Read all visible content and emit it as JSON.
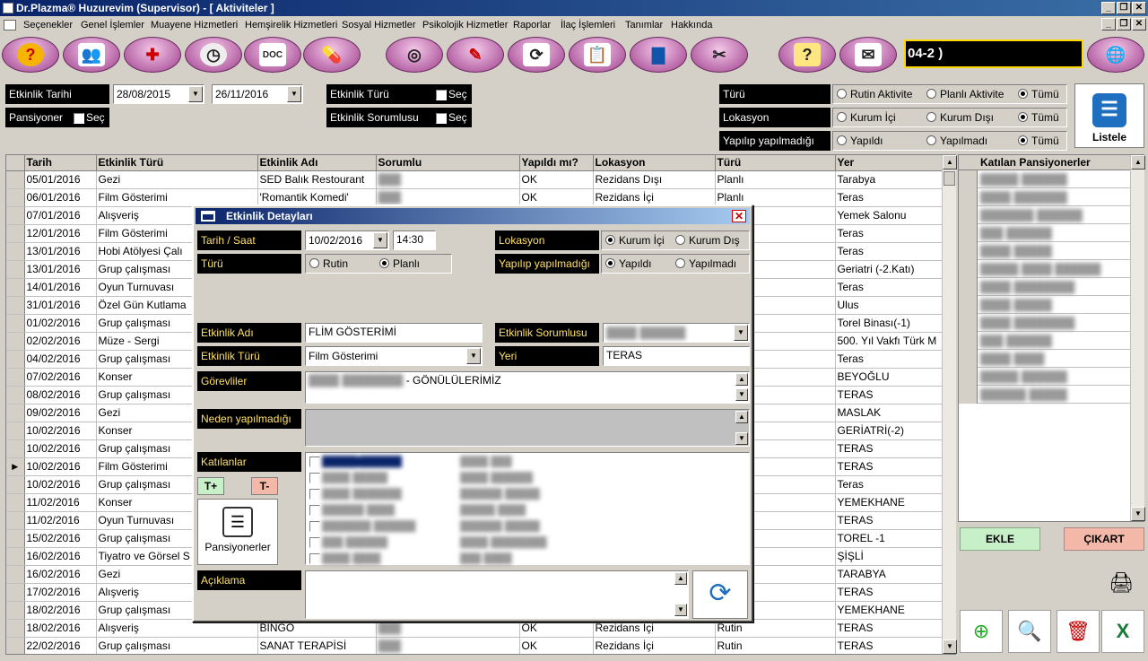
{
  "window": {
    "title": "Dr.Plazma® Huzurevim (Supervisor) - [ Aktiviteler ]",
    "min": "_",
    "restore": "❐",
    "close": "✕"
  },
  "menu": [
    "Seçenekler",
    "Genel İşlemler",
    "Muayene Hizmetleri",
    "Hemşirelik Hizmetleri",
    "Sosyal Hizmetler",
    "Psikolojik Hizmetler",
    "Raporlar",
    "İlaç İşlemleri",
    "Tanımlar",
    "Hakkında"
  ],
  "toolbar": {
    "ticker": "04-2 )",
    "icons": [
      "help-icon",
      "doctors-icon",
      "nurse-icon",
      "clock-icon",
      "document-icon",
      "pills-icon",
      "spiral-icon",
      "note-icon",
      "refresh-doc-icon",
      "clipboard-icon",
      "chart-icon",
      "tools-icon",
      "question-note-icon",
      "mail-icon",
      "globe-icon"
    ]
  },
  "filters": {
    "etkinlik_tarihi": "Etkinlik Tarihi",
    "date_from": "28/08/2015",
    "date_to": "26/11/2016",
    "pansiyoner": "Pansiyoner",
    "sec": "Seç",
    "etkinlik_turu": "Etkinlik Türü",
    "etkinlik_sorumlusu": "Etkinlik Sorumlusu",
    "turu": "Türü",
    "turu_opts": [
      "Rutin Aktivite",
      "Planlı Aktivite",
      "Tümü"
    ],
    "lokasyon": "Lokasyon",
    "lokasyon_opts": [
      "Kurum İçi",
      "Kurum Dışı",
      "Tümü"
    ],
    "yapilip": "Yapılıp yapılmadığı",
    "yapilip_opts": [
      "Yapıldı",
      "Yapılmadı",
      "Tümü"
    ],
    "listele": "Listele"
  },
  "grid": {
    "headers": [
      "Tarih",
      "Etkinlik Türü",
      "Etkinlik Adı",
      "Sorumlu",
      "Yapıldı mı?",
      "Lokasyon",
      "Türü",
      "Yer"
    ],
    "rows": [
      [
        "05/01/2016",
        "Gezi",
        "SED Balık Restourant",
        "███",
        "OK",
        "Rezidans Dışı",
        "Planlı",
        "Tarabya"
      ],
      [
        "06/01/2016",
        "Film Gösterimi",
        "'Romantik Komedi'",
        "███",
        "OK",
        "Rezidans İçi",
        "Planlı",
        "Teras"
      ],
      [
        "07/01/2016",
        "Alışveriş",
        "",
        "",
        "",
        "",
        "",
        "Yemek Salonu"
      ],
      [
        "12/01/2016",
        "Film Gösterimi",
        "",
        "",
        "",
        "",
        "",
        "Teras"
      ],
      [
        "13/01/2016",
        "Hobi Atölyesi Çalı",
        "",
        "",
        "",
        "",
        "",
        "Teras"
      ],
      [
        "13/01/2016",
        "Grup çalışması",
        "",
        "",
        "",
        "",
        "",
        "Geriatri (-2.Katı)"
      ],
      [
        "14/01/2016",
        "Oyun Turnuvası",
        "",
        "",
        "",
        "",
        "",
        "Teras"
      ],
      [
        "31/01/2016",
        "Özel Gün Kutlama",
        "",
        "",
        "",
        "",
        "",
        "Ulus"
      ],
      [
        "01/02/2016",
        "Grup çalışması",
        "",
        "",
        "",
        "",
        "",
        "Torel Binası(-1)"
      ],
      [
        "02/02/2016",
        "Müze - Sergi",
        "",
        "",
        "",
        "",
        "",
        "500. Yıl Vakfı Türk M"
      ],
      [
        "04/02/2016",
        "Grup çalışması",
        "",
        "",
        "",
        "",
        "",
        "Teras"
      ],
      [
        "07/02/2016",
        "Konser",
        "",
        "",
        "",
        "",
        "",
        "BEYOĞLU"
      ],
      [
        "08/02/2016",
        "Grup çalışması",
        "",
        "",
        "",
        "",
        "",
        "TERAS"
      ],
      [
        "09/02/2016",
        "Gezi",
        "",
        "",
        "",
        "",
        "",
        "MASLAK"
      ],
      [
        "10/02/2016",
        "Konser",
        "",
        "",
        "",
        "",
        "",
        "GERİATRİ(-2)"
      ],
      [
        "10/02/2016",
        "Grup çalışması",
        "",
        "",
        "",
        "",
        "",
        "TERAS"
      ],
      [
        "10/02/2016",
        "Film Gösterimi",
        "",
        "",
        "",
        "",
        "",
        "TERAS"
      ],
      [
        "10/02/2016",
        "Grup çalışması",
        "",
        "",
        "",
        "",
        "",
        "Teras"
      ],
      [
        "11/02/2016",
        "Konser",
        "",
        "",
        "",
        "",
        "",
        "YEMEKHANE"
      ],
      [
        "11/02/2016",
        "Oyun Turnuvası",
        "",
        "",
        "",
        "",
        "",
        "TERAS"
      ],
      [
        "15/02/2016",
        "Grup çalışması",
        "",
        "",
        "",
        "",
        "",
        "TOREL -1"
      ],
      [
        "16/02/2016",
        "Tiyatro ve Görsel S",
        "",
        "",
        "",
        "",
        "",
        "ŞİŞLİ"
      ],
      [
        "16/02/2016",
        "Gezi",
        "",
        "",
        "",
        "",
        "",
        "TARABYA"
      ],
      [
        "17/02/2016",
        "Alışveriş",
        "",
        "",
        "",
        "",
        "",
        "TERAS"
      ],
      [
        "18/02/2016",
        "Grup çalışması",
        "",
        "",
        "",
        "",
        "",
        "YEMEKHANE"
      ],
      [
        "18/02/2016",
        "Alışveriş",
        "BINGO",
        "███",
        "OK",
        "Rezidans İçi",
        "Rutin",
        "TERAS"
      ],
      [
        "22/02/2016",
        "Grup çalışması",
        "SANAT TERAPİSİ",
        "███",
        "OK",
        "Rezidans İçi",
        "Rutin",
        "TERAS"
      ]
    ],
    "current_row": 16
  },
  "katilan": {
    "header": "Katılan Pansiyonerler",
    "rows": [
      "█████ ██████",
      "████ ███████",
      "███████ ██████",
      "███ ██████",
      "████ █████",
      "█████ ████ ██████",
      "████ ████████",
      "████ █████",
      "████ ████████",
      "███ ██████",
      "████ ████",
      "█████ ██████",
      "██████ █████"
    ]
  },
  "buttons": {
    "ekle": "EKLE",
    "cikart": "ÇIKART"
  },
  "dialog": {
    "title": "Etkinlik Detayları",
    "tarih_saat": "Tarih / Saat",
    "date": "10/02/2016",
    "time": "14:30",
    "turu": "Türü",
    "turu_opts": [
      "Rutin",
      "Planlı"
    ],
    "lokasyon": "Lokasyon",
    "lok_opts": [
      "Kurum İçi",
      "Kurum Dış"
    ],
    "yapilip": "Yapılıp yapılmadığı",
    "yap_opts": [
      "Yapıldı",
      "Yapılmadı"
    ],
    "etkinlik_adi": "Etkinlik Adı",
    "etkinlik_adi_val": "FLİM GÖSTERİMİ",
    "etkinlik_sorumlusu": "Etkinlik Sorumlusu",
    "sorumlu_val": "████ ██████",
    "etkinlik_turu": "Etkinlik Türü",
    "etkinlik_turu_val": "Film Gösterimi",
    "yeri": "Yeri",
    "yeri_val": "TERAS",
    "gorevliler": "Görevliler",
    "gorevliler_prefix": "████ ████████",
    "gorevliler_val": " - GÖNÜLÜLERİMİZ",
    "neden": "Neden yapılmadığı",
    "katilanlar": "Katılanlar",
    "tplus": "T+",
    "tminus": "T-",
    "pansiyonerler": "Pansiyonerler",
    "katilanlar_list": [
      "█████ ██████",
      "████ █████",
      "████ ███████",
      "██████ ████",
      "███████ ██████",
      "███ ██████",
      "████ ████",
      "████ ███",
      "████ ██████",
      "██████ █████",
      "█████ ████",
      "██████ █████",
      "████ ████████",
      "███ ████"
    ],
    "aciklama": "Açıklama"
  }
}
